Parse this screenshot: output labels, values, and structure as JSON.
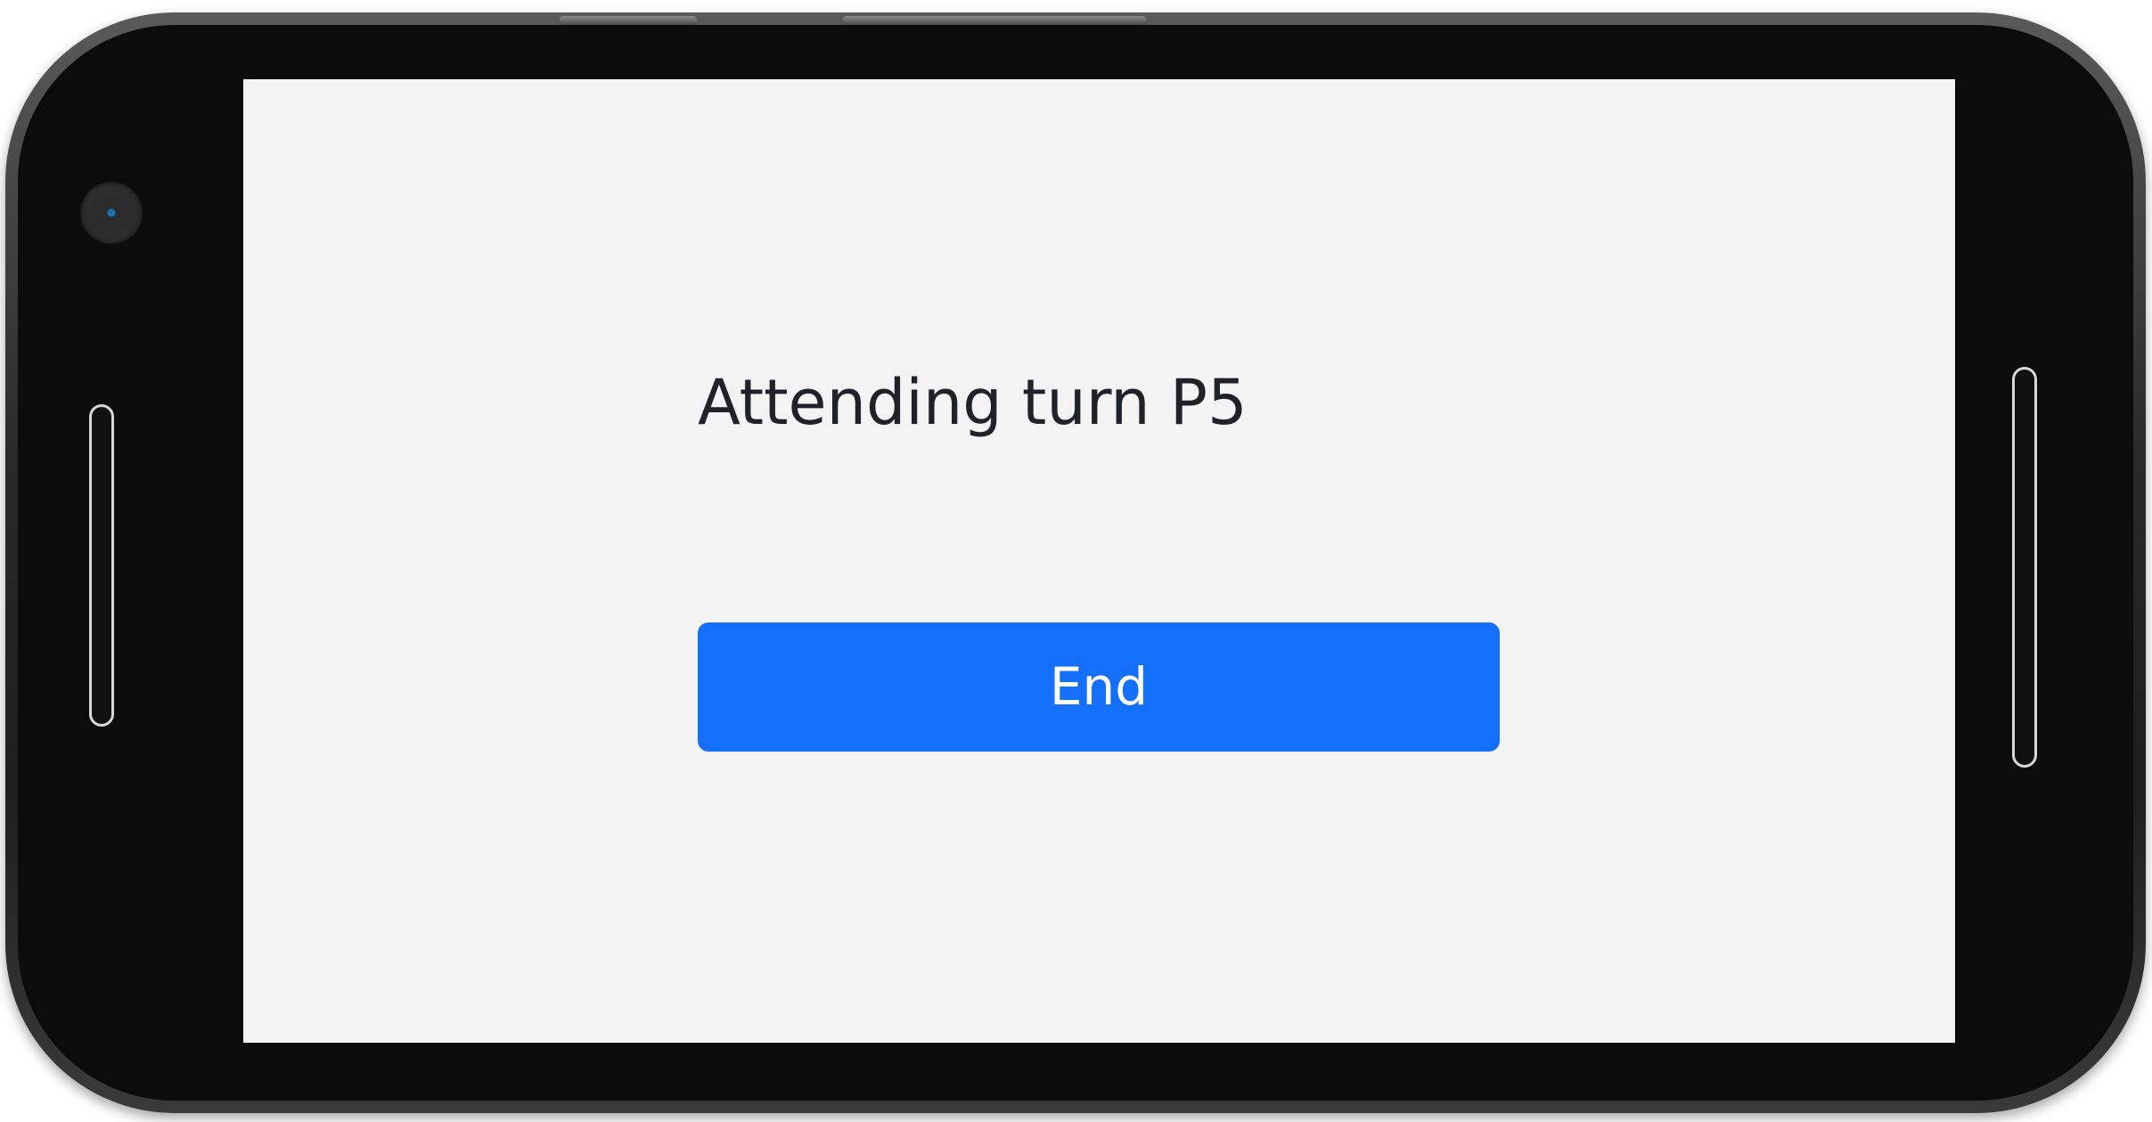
{
  "screen": {
    "turn_text": "Attending turn P5",
    "end_button_label": "End"
  },
  "colors": {
    "screen_background": "#f3f3f4",
    "text": "#1f2328",
    "button_accent": "#146ffb",
    "button_text": "#ffffff",
    "device_bezel": "#0c0c0c"
  }
}
